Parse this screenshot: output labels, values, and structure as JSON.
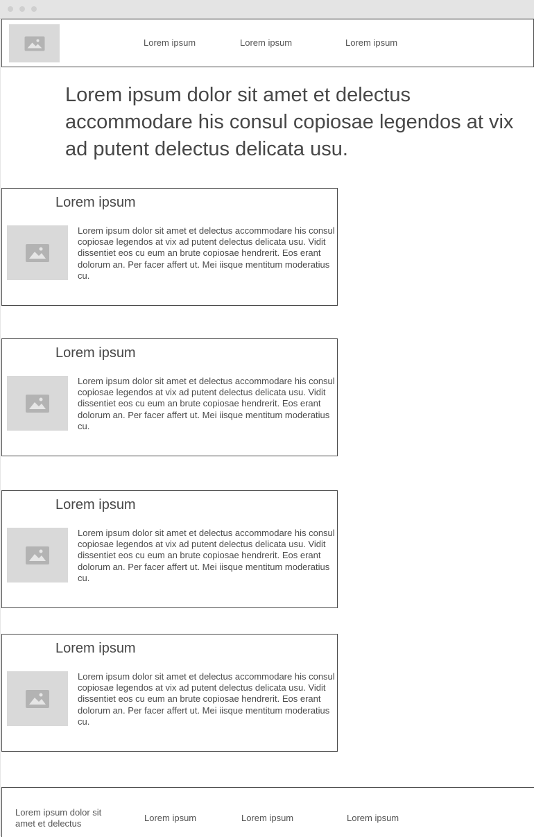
{
  "header": {
    "logo_icon": "image-placeholder-icon",
    "nav": [
      {
        "label": "Lorem ipsum"
      },
      {
        "label": "Lorem ipsum"
      },
      {
        "label": "Lorem ipsum"
      }
    ]
  },
  "hero": {
    "text": "Lorem ipsum dolor sit amet et delectus accommodare his consul copiosae legendos at vix ad putent delectus delicata usu."
  },
  "cards": [
    {
      "title": "Lorem ipsum",
      "image_icon": "image-placeholder-icon",
      "body": "Lorem ipsum dolor sit amet et delectus accommodare his consul copiosae legendos at vix ad putent delectus delicata usu. Vidit dissentiet eos cu eum an brute copiosae hendrerit. Eos erant dolorum an. Per facer affert ut. Mei iisque mentitum moderatius cu."
    },
    {
      "title": "Lorem ipsum",
      "image_icon": "image-placeholder-icon",
      "body": "Lorem ipsum dolor sit amet et delectus accommodare his consul copiosae legendos at vix ad putent delectus delicata usu. Vidit dissentiet eos cu eum an brute copiosae hendrerit. Eos erant dolorum an. Per facer affert ut. Mei iisque mentitum moderatius cu."
    },
    {
      "title": "Lorem ipsum",
      "image_icon": "image-placeholder-icon",
      "body": "Lorem ipsum dolor sit amet et delectus accommodare his consul copiosae legendos at vix ad putent delectus delicata usu. Vidit dissentiet eos cu eum an brute copiosae hendrerit. Eos erant dolorum an. Per facer affert ut. Mei iisque mentitum moderatius cu."
    },
    {
      "title": "Lorem ipsum",
      "image_icon": "image-placeholder-icon",
      "body": "Lorem ipsum dolor sit amet et delectus accommodare his consul copiosae legendos at vix ad putent delectus delicata usu. Vidit dissentiet eos cu eum an brute copiosae hendrerit. Eos erant dolorum an. Per facer affert ut. Mei iisque mentitum moderatius cu."
    }
  ],
  "footer": {
    "text": "Lorem ipsum dolor sit amet et delectus",
    "nav": [
      {
        "label": "Lorem ipsum"
      },
      {
        "label": "Lorem ipsum"
      },
      {
        "label": "Lorem ipsum"
      }
    ]
  },
  "colors": {
    "placeholder_bg": "#d9d9d9",
    "placeholder_icon": "#b3b3b3",
    "border": "#4a4a4a",
    "text": "#444444"
  }
}
